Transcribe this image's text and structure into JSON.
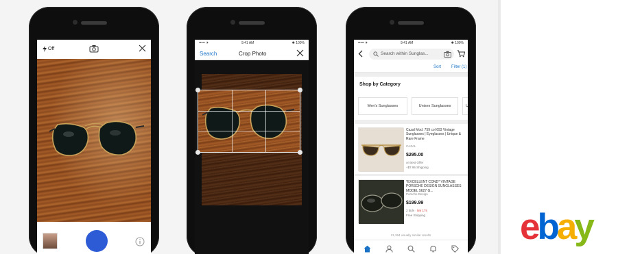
{
  "phone1": {
    "flash_label": "Off"
  },
  "phone2": {
    "search_label": "Search",
    "title": "Crop Photo",
    "status_carrier": "••••• ✈",
    "status_time": "9:41 AM",
    "status_battery": "✱ 100%"
  },
  "phone3": {
    "status_carrier": "••••• ✈",
    "status_time": "9:41 AM",
    "status_battery": "✱ 100%",
    "search_placeholder": "Search within Sunglas...",
    "sort_label": "Sort",
    "filter_label": "Filter (1)",
    "shop_by_category": "Shop by Category",
    "categories": [
      "Men's Sunglasses",
      "Unisex Sunglasses",
      "Un..."
    ],
    "items": [
      {
        "title": "Cazal Mod. 759 col 693 Vintage Sunglasses | Eyeglasses | Unique & Rare Frame",
        "subtitle": "CAZAL",
        "price": "$295.00",
        "meta1": "or Best Offer",
        "meta2": "+$7.95 Shipping"
      },
      {
        "title": "*EXCELLENT COND* VINTAGE PORSCHE DESIGN SUNGLASSES MODEL 5627 G...",
        "subtitle": "Porsche Design",
        "price": "$199.99",
        "meta1_prefix": "2 bids · ",
        "meta1_red": "5m 17s",
        "meta2": "Free Shipping"
      }
    ],
    "results_count": "21,394 visually similar results"
  },
  "brand": {
    "logo_letters": [
      "e",
      "b",
      "a",
      "y"
    ],
    "colors": {
      "e": "#e53238",
      "b": "#0064d2",
      "a": "#f5af02",
      "y": "#86b817"
    }
  },
  "colors": {
    "shutter": "#2d5bd6",
    "link": "#1a73c6"
  },
  "icons": {
    "phone1": [
      "flash-icon",
      "camera-switch-icon",
      "close-icon",
      "shutter-button",
      "info-icon"
    ],
    "phone3_tabs": [
      "home-icon",
      "profile-icon",
      "search-icon",
      "notifications-icon",
      "selling-icon"
    ]
  }
}
